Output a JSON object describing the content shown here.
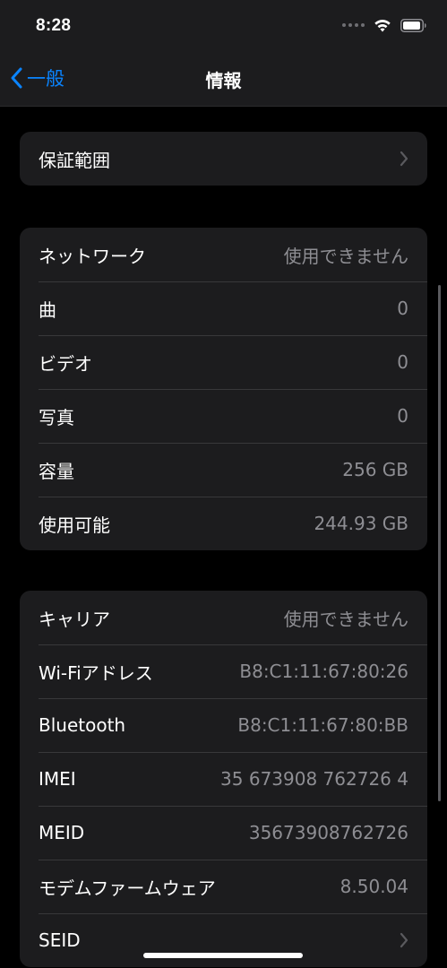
{
  "status_bar": {
    "time": "8:28"
  },
  "nav": {
    "back_label": "一般",
    "title": "情報"
  },
  "warranty": {
    "label": "保証範囲"
  },
  "media": [
    {
      "label": "ネットワーク",
      "value": "使用できません"
    },
    {
      "label": "曲",
      "value": "0"
    },
    {
      "label": "ビデオ",
      "value": "0"
    },
    {
      "label": "写真",
      "value": "0"
    },
    {
      "label": "容量",
      "value": "256 GB"
    },
    {
      "label": "使用可能",
      "value": "244.93 GB"
    }
  ],
  "device": [
    {
      "label": "キャリア",
      "value": "使用できません"
    },
    {
      "label": "Wi-Fiアドレス",
      "value": "B8:C1:11:67:80:26"
    },
    {
      "label": "Bluetooth",
      "value": "B8:C1:11:67:80:BB"
    },
    {
      "label": "IMEI",
      "value": "35 673908 762726 4"
    },
    {
      "label": "MEID",
      "value": "35673908762726"
    },
    {
      "label": "モデムファームウェア",
      "value": "8.50.04"
    },
    {
      "label": "SEID",
      "value": ""
    }
  ],
  "colors": {
    "accent": "#0a84ff",
    "background": "#000000",
    "cell": "#1c1c1e",
    "secondary_text": "#8e8e93"
  },
  "icons": [
    "back-chevron-icon",
    "wifi-icon",
    "battery-icon",
    "chevron-right-icon"
  ]
}
